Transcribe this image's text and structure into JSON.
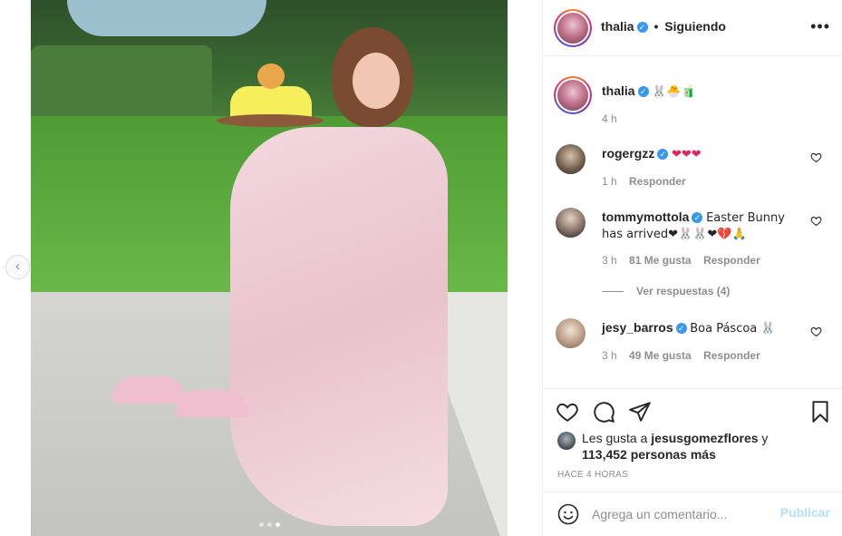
{
  "post": {
    "carousel": {
      "slide_count": 3,
      "active_slide": 3
    }
  },
  "header": {
    "username": "thalia",
    "verified": true,
    "separator": "•",
    "follow_state": "Siguiendo",
    "more_icon": "more-horizontal-icon"
  },
  "caption": {
    "username": "thalia",
    "text": "🐰🐣🧃",
    "time": "4 h"
  },
  "comments": [
    {
      "username": "rogergzz",
      "text": "❤❤❤",
      "time": "1 h",
      "likes": "",
      "reply_label": "Responder"
    },
    {
      "username": "tommymottola",
      "text": "Easter Bunny has arrived❤🐰🐰❤💔🙏",
      "time": "3 h",
      "likes": "81 Me gusta",
      "reply_label": "Responder"
    },
    {
      "username": "jesy_barros",
      "text": "Boa Páscoa 🐰",
      "time": "3 h",
      "likes": "49 Me gusta",
      "reply_label": "Responder"
    }
  ],
  "view_replies": "Ver respuestas (4)",
  "likes": {
    "prefix": "Les gusta a ",
    "user": "jesusgomezflores",
    "middle": " y",
    "count": "113,452 personas más"
  },
  "time_ago": "HACE 4 HORAS",
  "add_comment": {
    "placeholder": "Agrega un comentario...",
    "publish_label": "Publicar"
  },
  "colors": {
    "verified": "#3897f0",
    "muted_text": "#8e8e8e",
    "publish_disabled": "#b2dffc",
    "border": "#efefef"
  }
}
